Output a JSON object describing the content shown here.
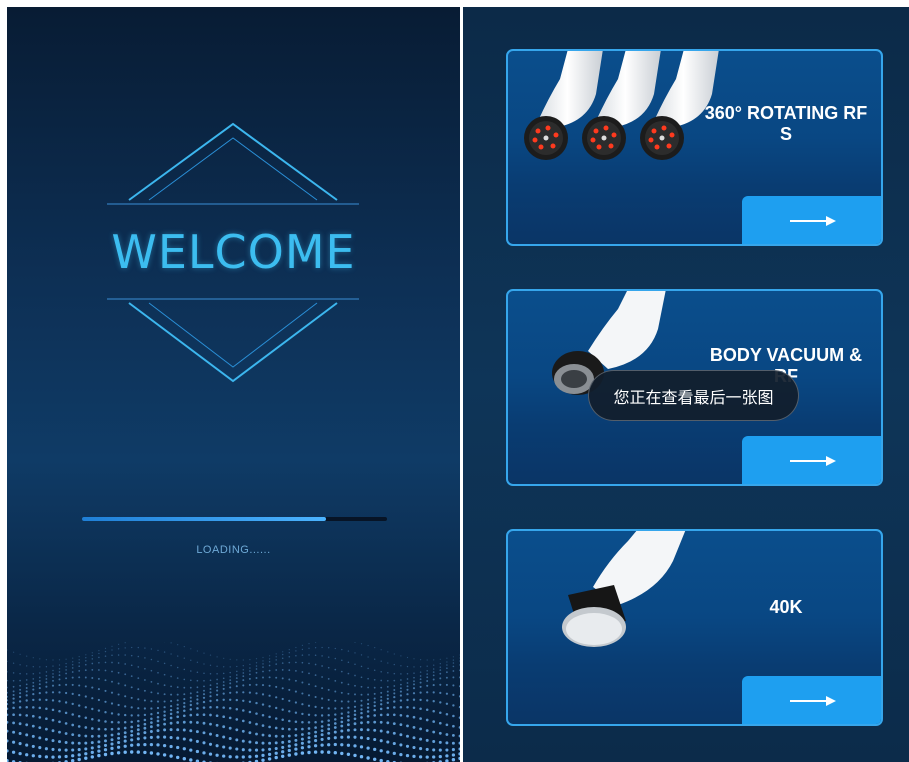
{
  "welcome_screen": {
    "title": "WELCOME",
    "loading_text": "LOADING......",
    "progress": 0.8
  },
  "product_list": {
    "cards": [
      {
        "title": "360° ROTATING RF S"
      },
      {
        "title": "BODY VACUUM & RF"
      },
      {
        "title": "40K"
      }
    ]
  },
  "toast": {
    "message": "您正在查看最后一张图"
  },
  "colors": {
    "accent": "#3cbdf0",
    "card_border": "#36a6ec",
    "button": "#1e9ff0",
    "background": "#0c2a48"
  },
  "icons": {
    "card_button": "arrow-right-icon",
    "welcome_frame": "diamond-frame-icon",
    "wave": "particle-wave"
  }
}
